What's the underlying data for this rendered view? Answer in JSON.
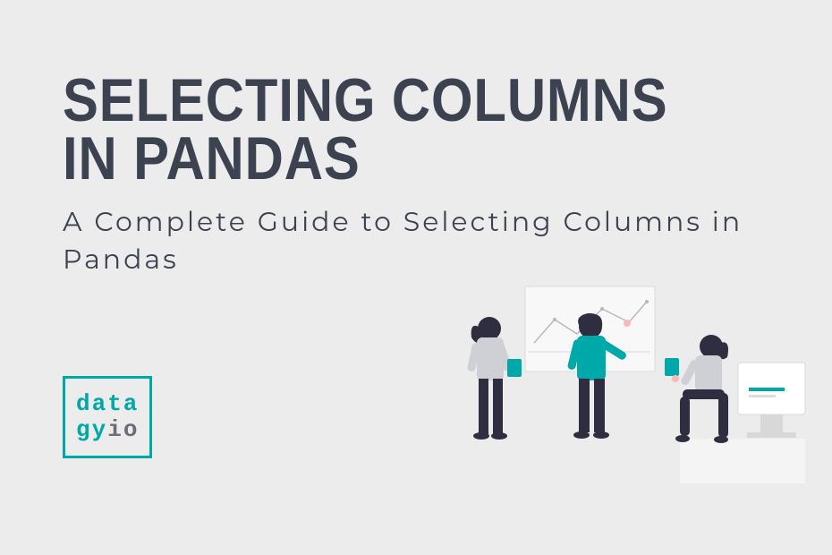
{
  "heading": {
    "title_line1": "Selecting Columns",
    "title_line2": "in Pandas",
    "subtitle": "A Complete Guide to Selecting Columns in Pandas"
  },
  "logo": {
    "segment1": "data",
    "segment2": "gy",
    "segment3": "io"
  },
  "colors": {
    "background": "#ececec",
    "text_dark": "#3d4250",
    "teal": "#00a9a9",
    "gray": "#6b6e76"
  },
  "illustration": {
    "description": "three-people-with-notes-and-board",
    "person1": "person-holding-note",
    "person2": "person-at-whiteboard",
    "person3": "person-sitting-with-laptop"
  }
}
